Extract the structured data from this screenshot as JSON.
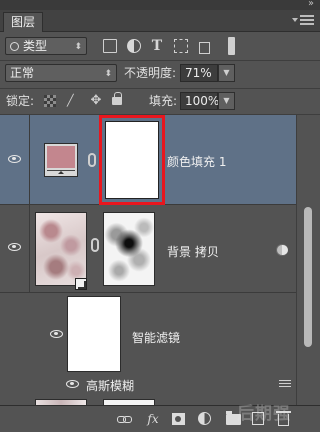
{
  "panel": {
    "tab_label": "图层"
  },
  "filter": {
    "kind_label": "类型"
  },
  "blend": {
    "mode": "正常",
    "opacity_label": "不透明度:",
    "opacity_value": "71%"
  },
  "lock": {
    "label": "锁定:",
    "fill_label": "填充:",
    "fill_value": "100%"
  },
  "layers": [
    {
      "name": "颜色填充 1",
      "type": "color-fill",
      "selected": true,
      "visible": true,
      "swatch_color": "#c3868e"
    },
    {
      "name": "背景 拷贝",
      "type": "smart-object",
      "selected": false,
      "visible": true
    },
    {
      "name": "智能滤镜",
      "type": "smart-filters",
      "visible": true
    },
    {
      "name": "高斯模糊",
      "type": "filter",
      "visible": true
    }
  ],
  "colors": {
    "panel_bg": "#535353",
    "selected_row": "#5f7187",
    "highlight_box": "#e8161e"
  },
  "watermark": "后期强"
}
